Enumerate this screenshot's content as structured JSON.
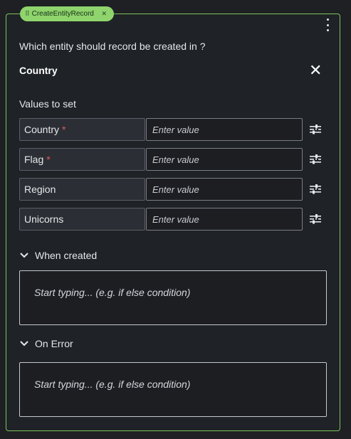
{
  "node": {
    "tag_label": "CreateEntityRecord",
    "question": "Which entity should record be created in ?",
    "entity_name": "Country",
    "values_title": "Values to set",
    "fields": [
      {
        "name": "Country",
        "required": true,
        "placeholder": "Enter value",
        "value": ""
      },
      {
        "name": "Flag",
        "required": true,
        "placeholder": "Enter value",
        "value": ""
      },
      {
        "name": "Region",
        "required": false,
        "placeholder": "Enter value",
        "value": ""
      },
      {
        "name": "Unicorns",
        "required": false,
        "placeholder": "Enter value",
        "value": ""
      }
    ],
    "required_marker": "*",
    "sections": [
      {
        "title": "When created",
        "placeholder": "Start typing... (e.g. if else condition)"
      },
      {
        "title": "On Error",
        "placeholder": "Start typing... (e.g. if else condition)"
      }
    ]
  },
  "icons": {
    "drag": "drag-handle-icon",
    "remove_tag": "close-small-icon",
    "menu": "kebab-menu-icon",
    "close": "close-icon",
    "field_options": "sliders-icon",
    "collapse": "chevron-down-icon"
  },
  "colors": {
    "accent": "#7cc35a",
    "tag_bg": "#8fd46c",
    "required": "#e05a5a",
    "background": "#1f2226"
  }
}
